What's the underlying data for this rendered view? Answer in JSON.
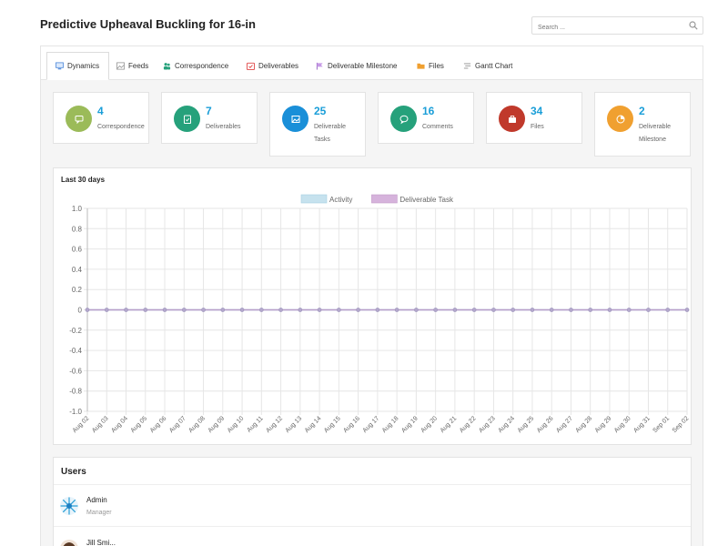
{
  "page": {
    "title": "Predictive Upheaval Buckling for 16-in"
  },
  "search": {
    "placeholder": "Search ..."
  },
  "tabs": [
    {
      "label": "Dynamics",
      "icon": "monitor-icon",
      "active": true
    },
    {
      "label": "Feeds",
      "icon": "image-icon"
    },
    {
      "label": "Correspondence",
      "icon": "people-icon"
    },
    {
      "label": "Deliverables",
      "icon": "calendar-check-icon"
    },
    {
      "label": "Deliverable Milestone",
      "icon": "flag-icon"
    },
    {
      "label": "Files",
      "icon": "folder-icon"
    },
    {
      "label": "Gantt Chart",
      "icon": "list-icon"
    }
  ],
  "stats": [
    {
      "value": "4",
      "label": "Correspondence",
      "color": "#9bbb59",
      "icon": "chat-icon"
    },
    {
      "value": "7",
      "label": "Deliverables",
      "color": "#26a17b",
      "icon": "clipboard-check-icon"
    },
    {
      "value": "25",
      "label": "Deliverable Tasks",
      "color": "#1a8fd8",
      "icon": "image-icon"
    },
    {
      "value": "16",
      "label": "Comments",
      "color": "#26a17b",
      "icon": "comment-icon"
    },
    {
      "value": "34",
      "label": "Files",
      "color": "#c0392b",
      "icon": "briefcase-icon"
    },
    {
      "value": "2",
      "label": "Deliverable Milestone",
      "color": "#f0a030",
      "icon": "pie-icon"
    }
  ],
  "chart": {
    "title": "Last 30 days"
  },
  "chart_data": {
    "type": "line",
    "title": "Last 30 days",
    "xlabel": "",
    "ylabel": "",
    "ylim": [
      -1.0,
      1.0
    ],
    "yticks": [
      "1.0",
      "0.8",
      "0.6",
      "0.4",
      "0.2",
      "0",
      "-0.2",
      "-0.4",
      "-0.6",
      "-0.8",
      "-1.0"
    ],
    "grid": true,
    "legend": "top-center",
    "x": [
      "Aug 02",
      "Aug 03",
      "Aug 04",
      "Aug 05",
      "Aug 06",
      "Aug 07",
      "Aug 08",
      "Aug 09",
      "Aug 10",
      "Aug 11",
      "Aug 12",
      "Aug 13",
      "Aug 14",
      "Aug 15",
      "Aug 16",
      "Aug 17",
      "Aug 18",
      "Aug 19",
      "Aug 20",
      "Aug 21",
      "Aug 22",
      "Aug 23",
      "Aug 24",
      "Aug 25",
      "Aug 26",
      "Aug 27",
      "Aug 28",
      "Aug 29",
      "Aug 30",
      "Aug 31",
      "Sep 01",
      "Sep 02"
    ],
    "series": [
      {
        "name": "Activity",
        "color": "#c6e2ee",
        "values": [
          0,
          0,
          0,
          0,
          0,
          0,
          0,
          0,
          0,
          0,
          0,
          0,
          0,
          0,
          0,
          0,
          0,
          0,
          0,
          0,
          0,
          0,
          0,
          0,
          0,
          0,
          0,
          0,
          0,
          0,
          0,
          0
        ]
      },
      {
        "name": "Deliverable Task",
        "color": "#d6b3dc",
        "values": [
          0,
          0,
          0,
          0,
          0,
          0,
          0,
          0,
          0,
          0,
          0,
          0,
          0,
          0,
          0,
          0,
          0,
          0,
          0,
          0,
          0,
          0,
          0,
          0,
          0,
          0,
          0,
          0,
          0,
          0,
          0,
          0
        ]
      }
    ]
  },
  "users": {
    "title": "Users",
    "list": [
      {
        "name": "Admin",
        "role": "Manager"
      },
      {
        "name": "Jill Smi...",
        "role": ""
      }
    ]
  }
}
